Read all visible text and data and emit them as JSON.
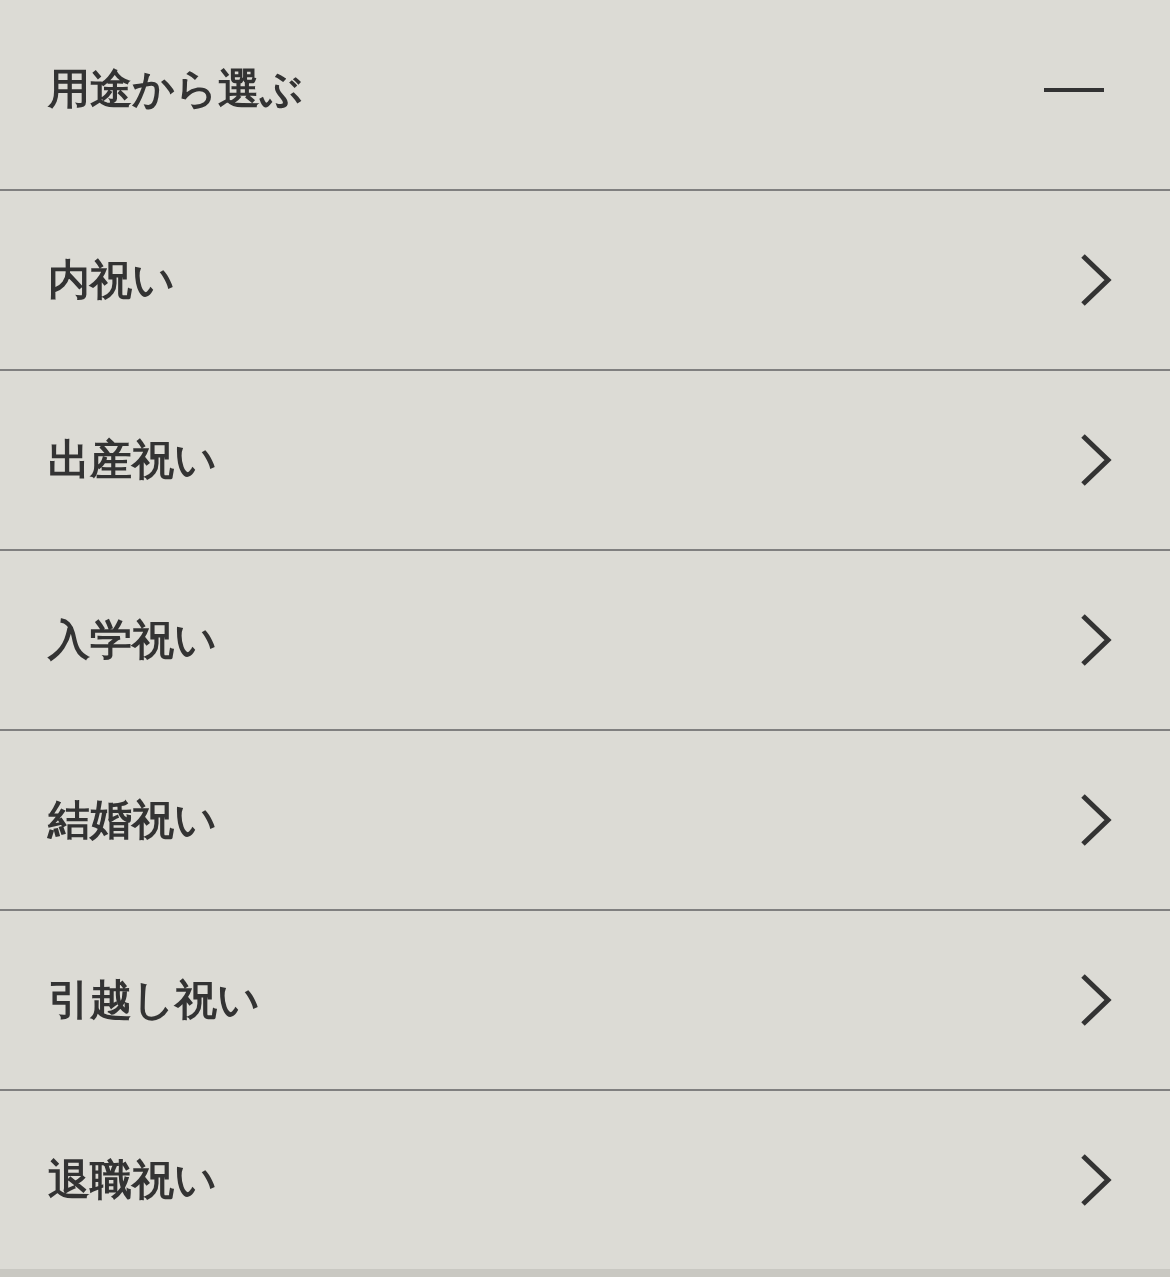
{
  "section": {
    "title": "用途から選ぶ",
    "expanded": true
  },
  "items": [
    {
      "label": "内祝い"
    },
    {
      "label": "出産祝い"
    },
    {
      "label": "入学祝い"
    },
    {
      "label": "結婚祝い"
    },
    {
      "label": "引越し祝い"
    },
    {
      "label": "退職祝い"
    }
  ]
}
